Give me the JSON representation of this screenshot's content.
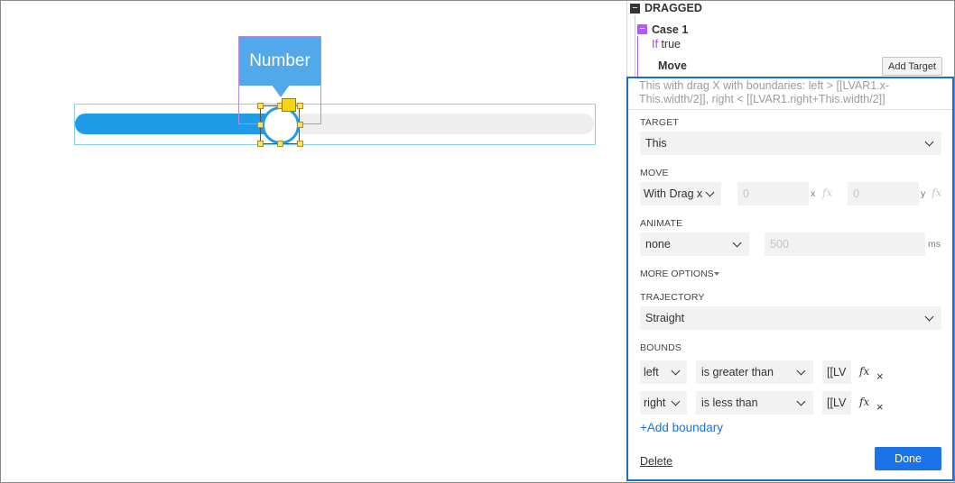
{
  "canvas": {
    "slider": {
      "value_fraction": 0.39,
      "track_color": "#eeeeee",
      "fill_color": "#1f9ce8"
    },
    "tooltip": {
      "text": "Number",
      "color": "#52a8e9"
    },
    "event_icon": "lightning-bolt-icon"
  },
  "interactions": {
    "event_label": "DRAGGED",
    "case": {
      "label": "Case 1",
      "condition_keyword": "If",
      "condition_value": "true"
    },
    "action_label": "Move",
    "add_target_label": "Add Target"
  },
  "editor": {
    "summary": "This with drag X  with boundaries: left > [[LVAR1.x-This.width/2]], right < [[LVAR1.right+This.width/2]]",
    "target": {
      "label": "TARGET",
      "value": "This"
    },
    "move": {
      "label": "MOVE",
      "mode": "With Drag x",
      "x_placeholder": "0",
      "x_unit": "x",
      "y_placeholder": "0",
      "y_unit": "y"
    },
    "animate": {
      "label": "ANIMATE",
      "easing": "none",
      "duration_placeholder": "500",
      "duration_unit": "ms"
    },
    "more_options_label": "MORE OPTIONS",
    "trajectory": {
      "label": "TRAJECTORY",
      "value": "Straight"
    },
    "bounds": {
      "label": "BOUNDS",
      "rows": [
        {
          "side": "left",
          "operator": "is greater than",
          "value": "[[LV"
        },
        {
          "side": "right",
          "operator": "is less than",
          "value": "[[LV"
        }
      ],
      "add_label": "+Add boundary"
    },
    "fx_glyph": "fx",
    "remove_glyph": "×",
    "delete_label": "Delete",
    "done_label": "Done",
    "accent_color": "#1a73e8"
  }
}
